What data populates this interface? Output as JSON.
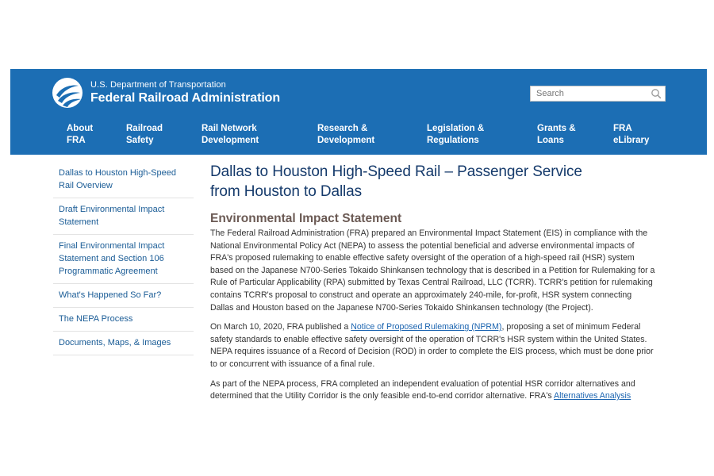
{
  "header": {
    "logo_line1": "U.S. Department of Transportation",
    "logo_line2": "Federal Railroad Administration",
    "search_placeholder": "Search",
    "nav": [
      {
        "line1": "About",
        "line2": "FRA"
      },
      {
        "line1": "Railroad",
        "line2": "Safety"
      },
      {
        "line1": "Rail Network",
        "line2": "Development"
      },
      {
        "line1": "Research &",
        "line2": "Development"
      },
      {
        "line1": "Legislation &",
        "line2": "Regulations"
      },
      {
        "line1": "Grants &",
        "line2": "Loans"
      },
      {
        "line1": "FRA",
        "line2": "eLibrary"
      }
    ]
  },
  "sidebar": {
    "items": [
      {
        "lines": [
          "Dallas to Houston High-Speed",
          "Rail Overview"
        ]
      },
      {
        "lines": [
          "Draft Environmental Impact",
          "Statement"
        ]
      },
      {
        "lines": [
          "Final Environmental Impact",
          "Statement and Section 106",
          "Programmatic Agreement"
        ]
      },
      {
        "lines": [
          "What's Happened So Far?"
        ]
      },
      {
        "lines": [
          "The NEPA Process"
        ]
      },
      {
        "lines": [
          "Documents, Maps, & Images"
        ]
      }
    ]
  },
  "main": {
    "title_line1": "Dallas to Houston High-Speed Rail – Passenger Service",
    "title_line2": "from Houston to Dallas",
    "subtitle": "Environmental Impact Statement",
    "para1": [
      "The Federal Railroad Administration (FRA) prepared an Environmental Impact Statement (EIS) in compliance with the",
      "National Environmental Policy Act (NEPA) to assess the potential beneficial and adverse environmental impacts of",
      "FRA's proposed rulemaking to enable effective safety oversight of the operation of a high-speed rail (HSR) system",
      "based on the Japanese N700-Series Tokaido Shinkansen technology that is described in a Petition for Rulemaking for a",
      "Rule of Particular Applicability (RPA) submitted by Texas Central Railroad, LLC (TCRR). TCRR's petition for rulemaking",
      "contains TCRR's proposal to construct and operate an approximately 240-mile, for-profit, HSR system connecting",
      "Dallas and Houston based on the Japanese N700-Series Tokaido Shinkansen technology (the Project)."
    ],
    "para2_l1_before": "On March 10, 2020, FRA published a ",
    "para2_link": "Notice of Proposed Rulemaking (NPRM)",
    "para2_l1_after": ", proposing a set of minimum Federal",
    "para2_rest": [
      "safety standards to enable effective safety oversight of the operation of TCRR's HSR system within the United States.",
      "NEPA requires issuance of a Record of Decision (ROD) in order to complete the EIS process, which must be done prior",
      "to or concurrent with issuance of a final rule."
    ],
    "para3_l1": "As part of the NEPA process, FRA completed an independent evaluation of potential HSR corridor alternatives and",
    "para3_l2_before": "determined that the Utility Corridor is the only feasible end-to-end corridor alternative. FRA's ",
    "para3_link": "Alternatives Analysis"
  },
  "colors": {
    "header_bg": "#1c6eb4",
    "title": "#153a6b",
    "subtitle": "#6b5a54",
    "link": "#1b64b0"
  }
}
